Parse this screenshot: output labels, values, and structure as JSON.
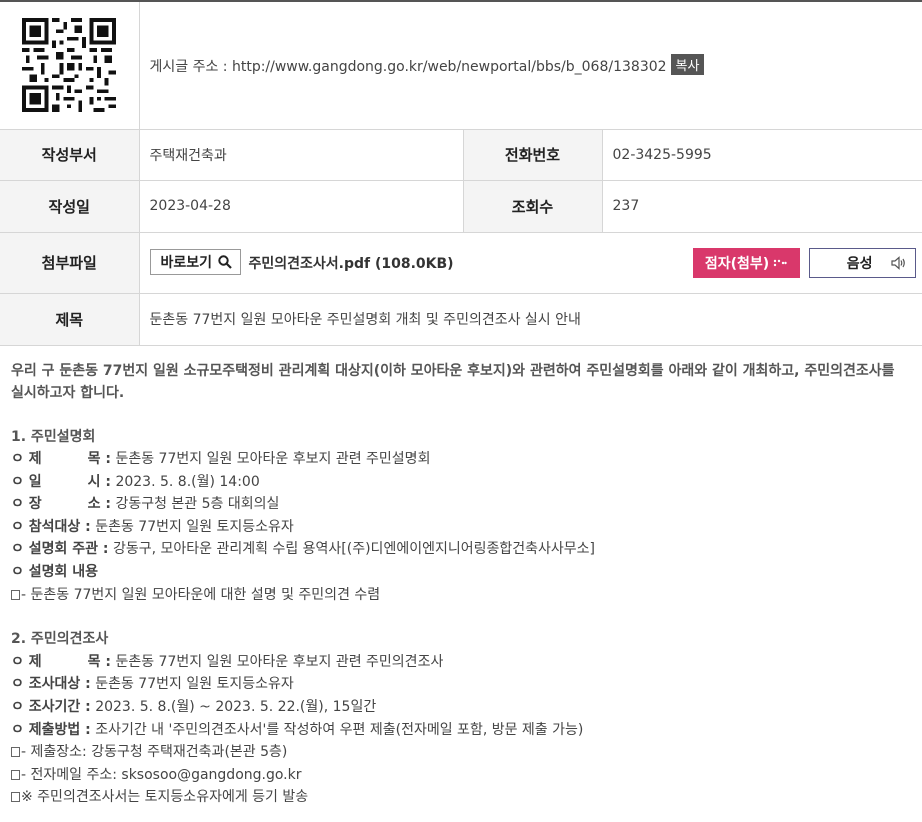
{
  "post": {
    "url_label": "게시글 주소 : http://www.gangdong.go.kr/web/newportal/bbs/b_068/138302",
    "copy_label": "복사"
  },
  "info": {
    "dept_label": "작성부서",
    "dept_value": "주택재건축과",
    "phone_label": "전화번호",
    "phone_value": "02-3425-5995",
    "date_label": "작성일",
    "date_value": "2023-04-28",
    "views_label": "조회수",
    "views_value": "237",
    "attach_label": "첨부파일",
    "view_button": "바로보기",
    "file_name": "주민의견조사서.pdf (108.0KB)",
    "braille_button": "점자(첨부)",
    "voice_button": "음성",
    "title_label": "제목",
    "title_value": "둔촌동 77번지 일원 모아타운 주민설명회 개최 및 주민의견조사 실시 안내"
  },
  "content": {
    "lead": "우리 구 둔촌동 77번지 일원 소규모주택정비 관리계획 대상지(이하 모아타운 후보지)와 관련하여 주민설명회를 아래와 같이 개최하고, 주민의견조사를 실시하고자 합니다.",
    "sec1": "1. 주민설명회",
    "s1": [
      {
        "k1": "ㅇ 제",
        "k2": "목 :",
        "v": " 둔촌동 77번지 일원 모아타운 후보지 관련 주민설명회"
      },
      {
        "k1": "ㅇ 일",
        "k2": "시 :",
        "v": " 2023. 5. 8.(월) 14:00"
      },
      {
        "k1": "ㅇ 장",
        "k2": "소 :",
        "v": " 강동구청 본관 5층 대회의실"
      }
    ],
    "s1_target_k": "ㅇ 참석대상 :",
    "s1_target_v": " 둔촌동 77번지 일원 토지등소유자",
    "s1_host_k": "ㅇ 설명회 주관 :",
    "s1_host_v": " 강동구, 모아타운 관리계획 수립 용역사[(주)디엔에이엔지니어링종합건축사사무소]",
    "s1_content_k": "ㅇ 설명회 내용",
    "s1_content_v": "- 둔촌동 77번지 일원 모아타운에 대한 설명 및 주민의견 수렴",
    "sec2": "2. 주민의견조사",
    "s2_title_k1": "ㅇ 제",
    "s2_title_k2": "목 :",
    "s2_title_v": " 둔촌동 77번지 일원 모아타운 후보지 관련 주민의견조사",
    "s2_target_k": "ㅇ 조사대상 :",
    "s2_target_v": " 둔촌동 77번지 일원 토지등소유자",
    "s2_period_k": "ㅇ 조사기간 :",
    "s2_period_v": " 2023. 5. 8.(월) ~ 2023. 5. 22.(월), 15일간",
    "s2_method_k": "ㅇ 제출방법 :",
    "s2_method_v": " 조사기간 내 '주민의견조사서'를 작성하여 우편 제출(전자메일 포함, 방문 제출 가능)",
    "s2_place": "- 제출장소: 강동구청 주택재건축과(본관 5층)",
    "s2_email": "- 전자메일 주소: sksosoo@gangdong.go.kr",
    "s2_note": "※ 주민의견조사서는 토지등소유자에게 등기 발송"
  }
}
